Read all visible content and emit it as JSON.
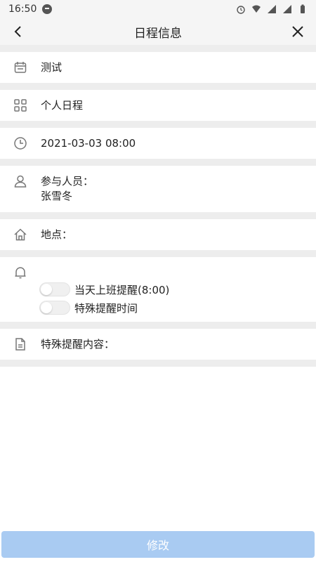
{
  "status": {
    "time": "16:50",
    "icons": [
      "message-icon",
      "alarm-icon",
      "wifi-icon",
      "signal-icon",
      "signal-icon",
      "battery-icon"
    ]
  },
  "header": {
    "title": "日程信息",
    "back_icon": "chevron-left-icon",
    "close_icon": "close-icon"
  },
  "rows": {
    "title": {
      "icon": "calendar-icon",
      "text": "测试"
    },
    "type": {
      "icon": "grid-icon",
      "text": "个人日程"
    },
    "datetime": {
      "icon": "clock-icon",
      "text": "2021-03-03 08:00"
    },
    "participants": {
      "icon": "person-icon",
      "label": "参与人员：",
      "value": "张雪冬"
    },
    "location": {
      "icon": "home-icon",
      "label": "地点："
    },
    "reminder": {
      "icon": "bell-icon",
      "options": [
        {
          "label": "当天上班提醒(8:00)",
          "checked": false
        },
        {
          "label": "特殊提醒时间",
          "checked": false
        }
      ]
    },
    "content": {
      "icon": "document-icon",
      "label": "特殊提醒内容："
    }
  },
  "footer": {
    "button_label": "修改"
  },
  "colors": {
    "primary_button": "#a9cbf2",
    "gap": "#ededed",
    "icon": "#777777"
  }
}
